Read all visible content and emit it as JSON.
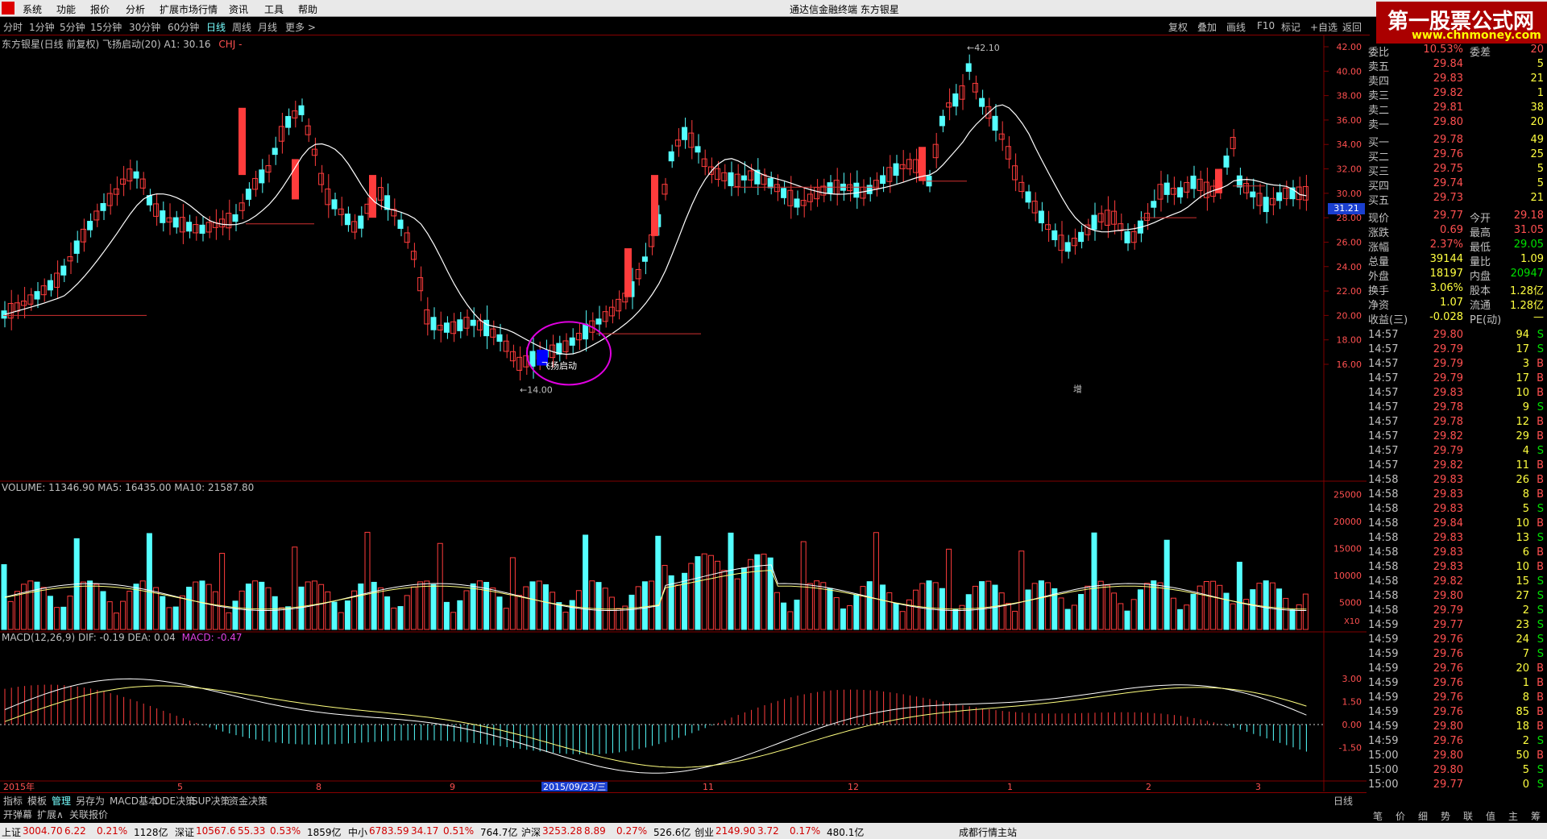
{
  "menu": {
    "items": [
      "系统",
      "功能",
      "报价",
      "分析",
      "扩展市场行情",
      "资讯",
      "工具",
      "帮助"
    ],
    "title": "通达信金融终端    东方银星"
  },
  "brand": {
    "name": "第一股票公式网",
    "url": "www.chnmoney.com"
  },
  "periods": [
    "分时",
    "1分钟",
    "5分钟",
    "15分钟",
    "30分钟",
    "60分钟",
    "日线",
    "周线",
    "月线",
    "更多 >"
  ],
  "selected_period": "日线",
  "toolbar_right": [
    "复权",
    "叠加",
    "画线",
    "F10",
    "标记",
    "+自选",
    "返回"
  ],
  "chart": {
    "header": "东方银星(日线 前复权) 飞扬启动(20) A1: 30.16",
    "header_extra": "CHJ -",
    "price_axis": [
      "42.00",
      "40.00",
      "38.00",
      "36.00",
      "34.00",
      "32.00",
      "30.00",
      "28.00",
      "26.00",
      "24.00",
      "22.00",
      "20.00",
      "18.00",
      "16.00"
    ],
    "current_price_tag": "31.21",
    "high_label": "42.10",
    "low_label": "14.00",
    "signal_label": "飞扬启动",
    "zeng_label": "增",
    "volume_header": "VOLUME: 11346.90  MA5: 16435.00  MA10: 21587.80",
    "volume_axis": [
      "25000",
      "20000",
      "15000",
      "10000",
      "5000"
    ],
    "volume_unit": "X10",
    "macd_header_prefix": "MACD(12,26,9)  DIF: -0.19  DEA: 0.04",
    "macd_header_value": "MACD: -0.47",
    "macd_axis": [
      "3.00",
      "1.50",
      "0.00",
      "-1.50"
    ],
    "date_axis": [
      "2015年",
      "5",
      "8",
      "9",
      "2015/09/23/三",
      "11",
      "12",
      "1",
      "2",
      "3"
    ],
    "period_tag": "日线"
  },
  "order_book": {
    "top_labels": [
      "委比",
      "10.53%",
      "委差",
      "20"
    ],
    "asks": [
      {
        "label": "卖五",
        "price": "29.84",
        "vol": "5"
      },
      {
        "label": "卖四",
        "price": "29.83",
        "vol": "21"
      },
      {
        "label": "卖三",
        "price": "29.82",
        "vol": "1"
      },
      {
        "label": "卖二",
        "price": "29.81",
        "vol": "38"
      },
      {
        "label": "卖一",
        "price": "29.80",
        "vol": "20"
      }
    ],
    "bids": [
      {
        "label": "买一",
        "price": "29.78",
        "vol": "49"
      },
      {
        "label": "买二",
        "price": "29.76",
        "vol": "25"
      },
      {
        "label": "买三",
        "price": "29.75",
        "vol": "5"
      },
      {
        "label": "买四",
        "price": "29.74",
        "vol": "5"
      },
      {
        "label": "买五",
        "price": "29.73",
        "vol": "21"
      }
    ]
  },
  "quote": [
    [
      "现价",
      "29.77",
      "今开",
      "29.18"
    ],
    [
      "涨跌",
      "0.69",
      "最高",
      "31.05"
    ],
    [
      "涨幅",
      "2.37%",
      "最低",
      "29.05"
    ],
    [
      "总量",
      "39144",
      "量比",
      "1.09"
    ],
    [
      "外盘",
      "18197",
      "内盘",
      "20947"
    ],
    [
      "换手",
      "3.06%",
      "股本",
      "1.28亿"
    ],
    [
      "净资",
      "1.07",
      "流通",
      "1.28亿"
    ],
    [
      "收益(三)",
      "-0.028",
      "PE(动)",
      "—"
    ]
  ],
  "ticks": [
    [
      "14:57",
      "29.80",
      "94",
      "S"
    ],
    [
      "14:57",
      "29.79",
      "17",
      "S"
    ],
    [
      "14:57",
      "29.79",
      "3",
      "B"
    ],
    [
      "14:57",
      "29.79",
      "17",
      "B"
    ],
    [
      "14:57",
      "29.83",
      "10",
      "B"
    ],
    [
      "14:57",
      "29.78",
      "9",
      "S"
    ],
    [
      "14:57",
      "29.78",
      "12",
      "B"
    ],
    [
      "14:57",
      "29.82",
      "29",
      "B"
    ],
    [
      "14:57",
      "29.79",
      "4",
      "S"
    ],
    [
      "14:57",
      "29.82",
      "11",
      "B"
    ],
    [
      "14:58",
      "29.83",
      "26",
      "B"
    ],
    [
      "14:58",
      "29.83",
      "8",
      "B"
    ],
    [
      "14:58",
      "29.83",
      "5",
      "S"
    ],
    [
      "14:58",
      "29.84",
      "10",
      "B"
    ],
    [
      "14:58",
      "29.83",
      "13",
      "S"
    ],
    [
      "14:58",
      "29.83",
      "6",
      "B"
    ],
    [
      "14:58",
      "29.83",
      "10",
      "B"
    ],
    [
      "14:58",
      "29.82",
      "15",
      "S"
    ],
    [
      "14:58",
      "29.80",
      "27",
      "S"
    ],
    [
      "14:58",
      "29.79",
      "2",
      "S"
    ],
    [
      "14:59",
      "29.77",
      "23",
      "S"
    ],
    [
      "14:59",
      "29.76",
      "24",
      "S"
    ],
    [
      "14:59",
      "29.76",
      "7",
      "S"
    ],
    [
      "14:59",
      "29.76",
      "20",
      "B"
    ],
    [
      "14:59",
      "29.76",
      "1",
      "B"
    ],
    [
      "14:59",
      "29.76",
      "8",
      "B"
    ],
    [
      "14:59",
      "29.76",
      "85",
      "B"
    ],
    [
      "14:59",
      "29.80",
      "18",
      "B"
    ],
    [
      "14:59",
      "29.76",
      "2",
      "S"
    ],
    [
      "15:00",
      "29.80",
      "50",
      "B"
    ],
    [
      "15:00",
      "29.80",
      "5",
      "S"
    ],
    [
      "15:00",
      "29.77",
      "0",
      "S"
    ]
  ],
  "bottom_tabs": [
    "指标",
    "模板",
    "管理",
    "另存为",
    "MACD基本",
    "DDE决策",
    "SUP决策",
    "资金决策"
  ],
  "bottom_tabs2": [
    "开弹幕",
    "扩展∧",
    "关联报价"
  ],
  "right_bottom": [
    "笔",
    "价",
    "细",
    "势",
    "联",
    "值",
    "主",
    "筹"
  ],
  "status": {
    "items": [
      {
        "name": "上证",
        "value": "3004.70",
        "chg": "6.22",
        "pct": "0.21%",
        "amt": "1128亿"
      },
      {
        "name": "深证",
        "value": "10567.6",
        "chg": "55.33",
        "pct": "0.53%",
        "amt": "1859亿"
      },
      {
        "name": "中小",
        "value": "6783.59",
        "chg": "34.17",
        "pct": "0.51%",
        "amt": "764.7亿"
      },
      {
        "name": "沪深",
        "value": "3253.28",
        "chg": "8.89",
        "pct": "0.27%",
        "amt": "526.6亿"
      },
      {
        "name": "创业",
        "value": "2149.90",
        "chg": "3.72",
        "pct": "0.17%",
        "amt": "480.1亿"
      }
    ],
    "site": "成都行情主站"
  },
  "colors": {
    "up": "#ff3c3c",
    "down": "#54ffff",
    "ma": "#ffffff",
    "ma10": "#ffff80",
    "signal": "#e000e0",
    "highlight": "#0000ff"
  }
}
